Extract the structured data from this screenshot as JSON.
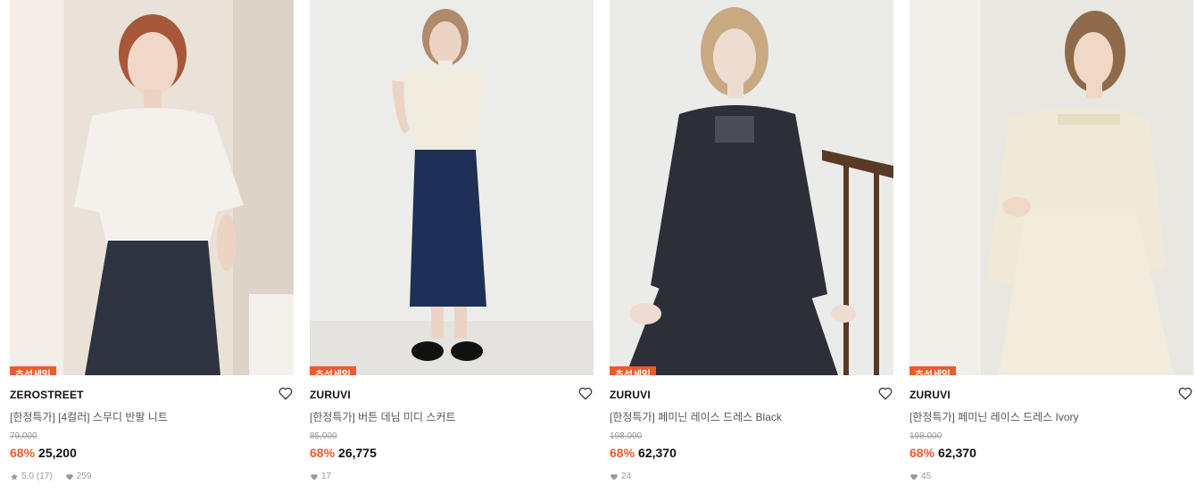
{
  "products": [
    {
      "badge": "추석세일",
      "brand": "ZEROSTREET",
      "title": "[한정특가] [4컬러] 스무디 반팔 니트",
      "original_price": "79,000",
      "discount": "68%",
      "price": "25,200",
      "rating": "5.0",
      "review_count": "(17)",
      "likes": "259"
    },
    {
      "badge": "추석세일",
      "brand": "ZURUVI",
      "title": "[한정특가] 버튼 데님 미디 스커트",
      "original_price": "85,000",
      "discount": "68%",
      "price": "26,775",
      "likes": "17"
    },
    {
      "badge": "추석세일",
      "brand": "ZURUVI",
      "title": "[한정특가] 페미닌 레이스 드레스 Black",
      "original_price": "198,000",
      "discount": "68%",
      "price": "62,370",
      "likes": "24"
    },
    {
      "badge": "추석세일",
      "brand": "ZURUVI",
      "title": "[한정특가] 페미닌 레이스 드레스 Ivory",
      "original_price": "198,000",
      "discount": "68%",
      "price": "62,370",
      "likes": "45"
    }
  ],
  "colors": {
    "accent": "#f05a28",
    "meta_gray": "#9a9a9a"
  },
  "icons": {
    "wishlist": "heart-outline-icon",
    "rating": "star-icon",
    "likes": "heart-filled-icon"
  }
}
